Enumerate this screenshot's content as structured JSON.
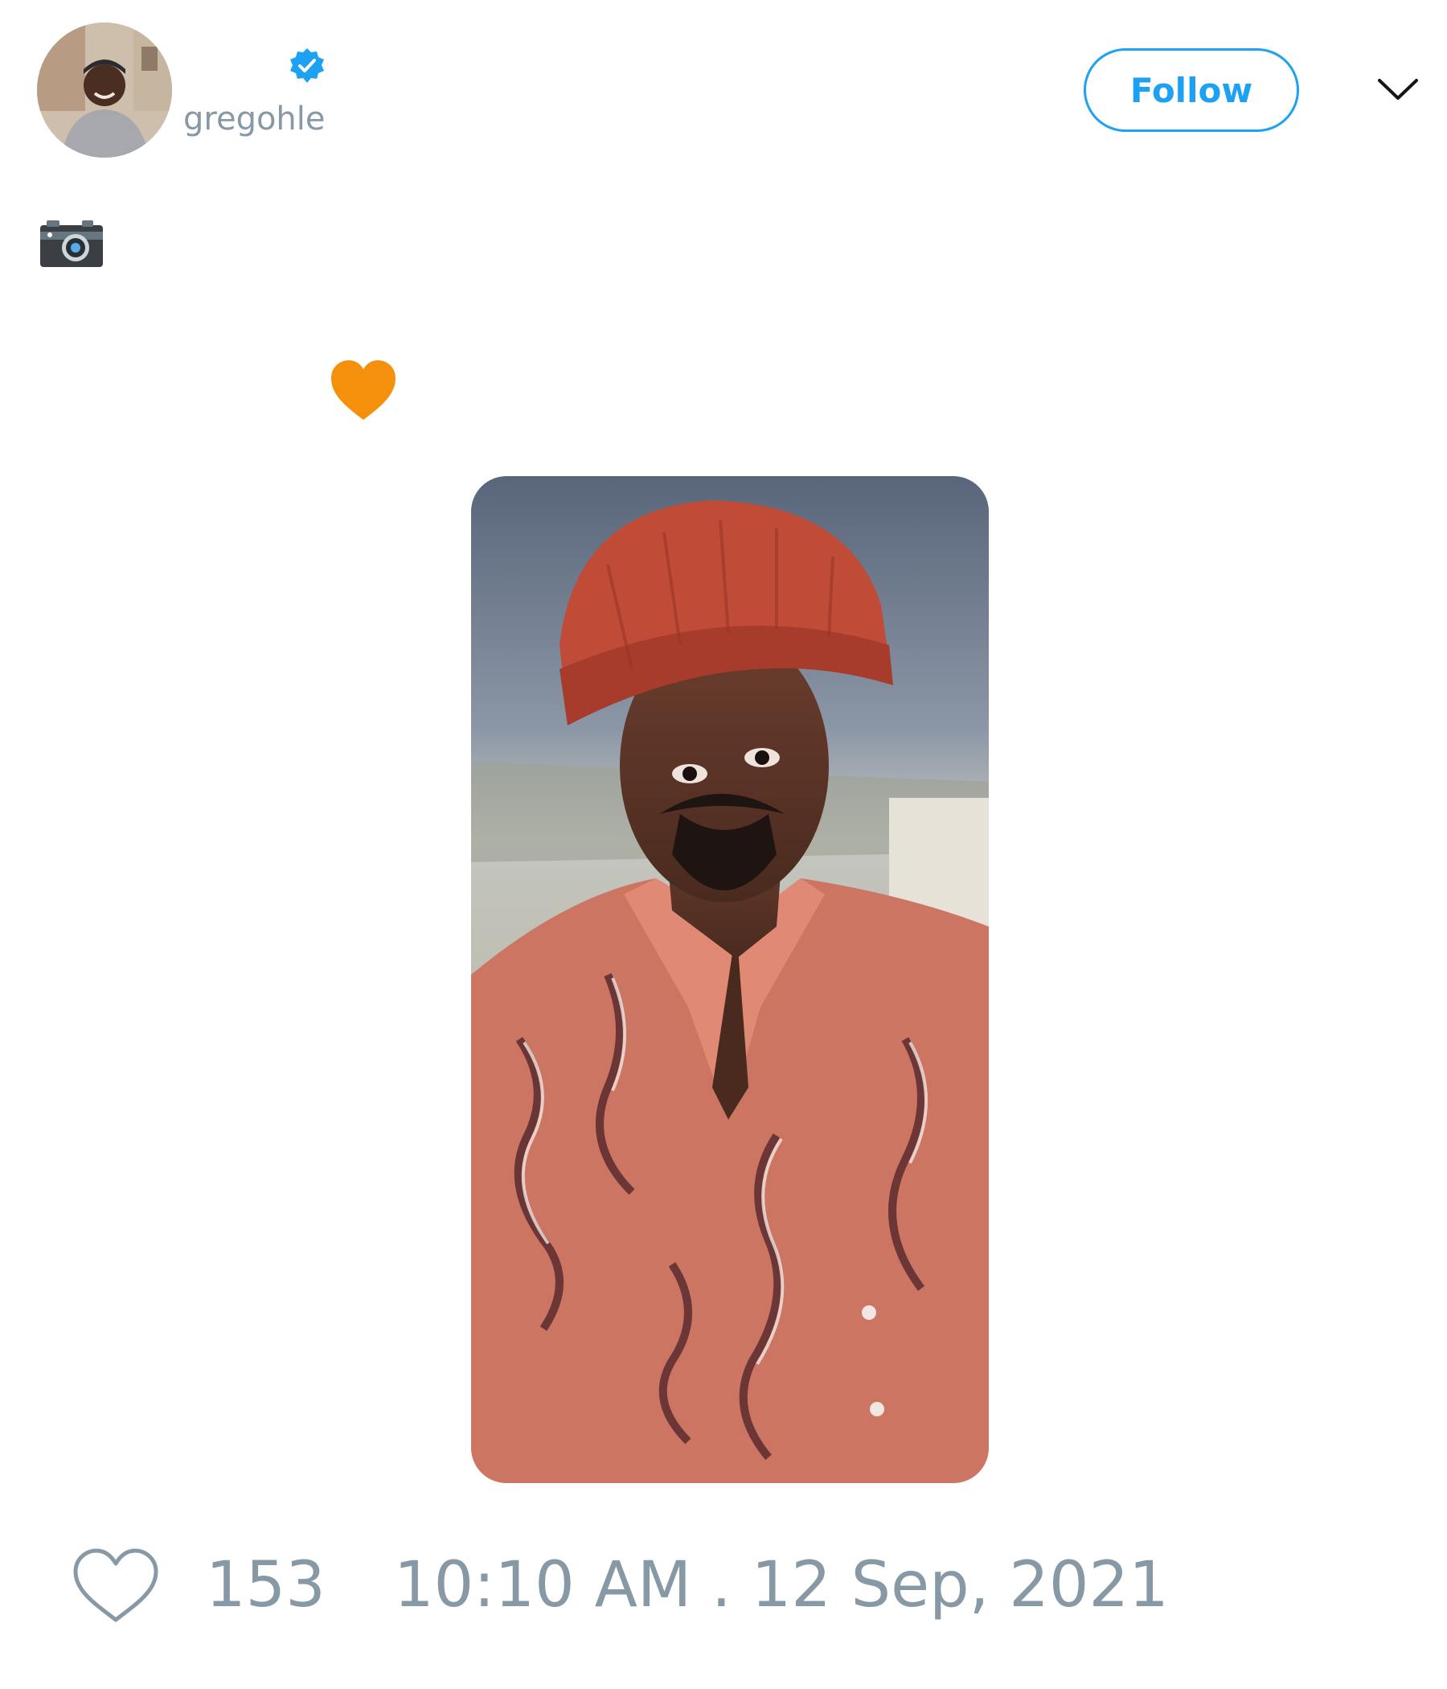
{
  "tweet": {
    "author": {
      "handle": "gregohle",
      "verified": true
    },
    "follow_label": "Follow",
    "text_emojis": [
      "camera-emoji",
      "orange-heart-emoji"
    ],
    "media": {
      "type": "photo"
    },
    "likes": "153",
    "timestamp": "10:10 AM . 12 Sep, 2021"
  },
  "colors": {
    "accent": "#1da1f2",
    "muted_text": "#8899a6",
    "heart_emoji": "#f4900c"
  }
}
